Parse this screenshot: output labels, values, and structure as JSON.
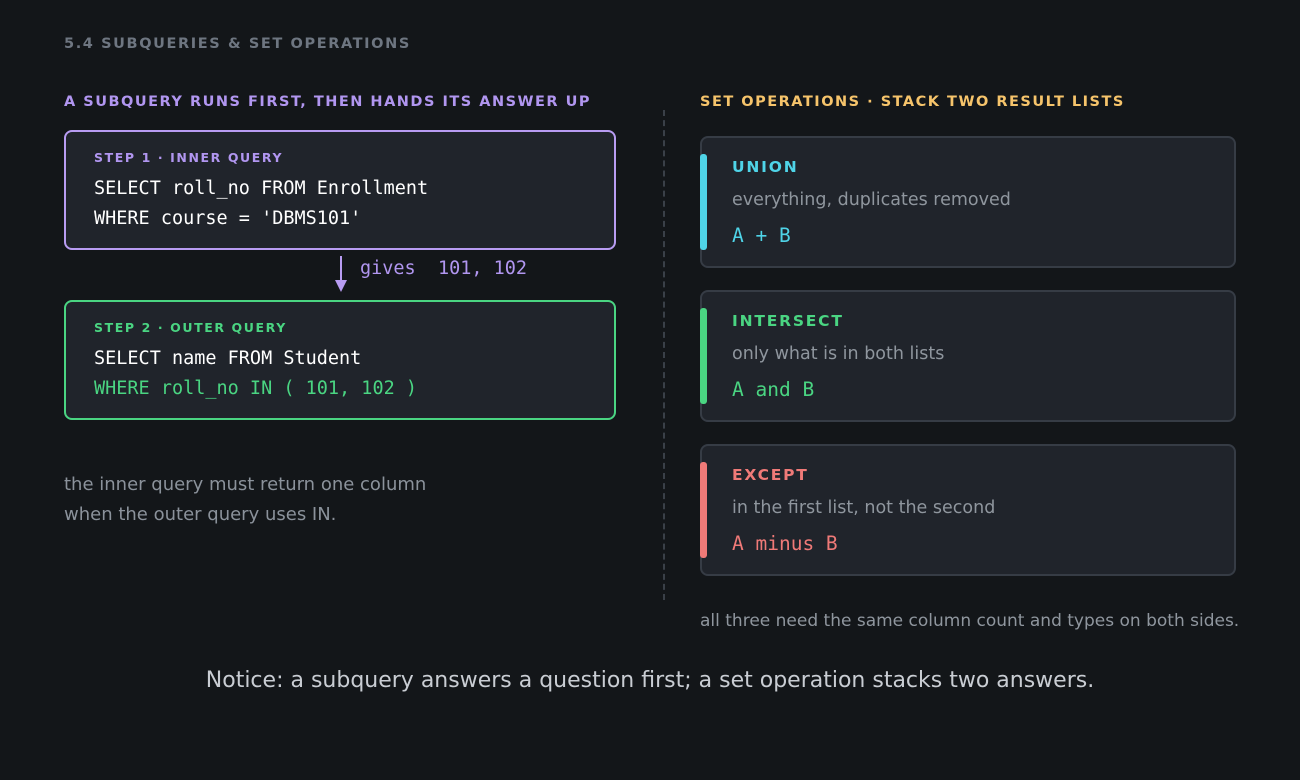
{
  "section_label": "5.4  SUBQUERIES & SET OPERATIONS",
  "left": {
    "heading": "A SUBQUERY RUNS FIRST, THEN HANDS ITS ANSWER UP",
    "inner": {
      "step_label": "STEP 1  ·  INNER QUERY",
      "line1": "SELECT roll_no FROM Enrollment",
      "line2": "WHERE course = 'DBMS101'"
    },
    "gives": "gives  101, 102",
    "outer": {
      "step_label": "STEP 2  ·  OUTER QUERY",
      "line1": "SELECT name FROM Student",
      "line2": "WHERE roll_no IN ( 101, 102 )"
    },
    "note": [
      "the inner query must return one column",
      "when the outer query uses IN."
    ]
  },
  "right": {
    "heading": "SET OPERATIONS  ·  STACK TWO RESULT LISTS",
    "cards": [
      {
        "title": "UNION",
        "desc": "everything, duplicates removed",
        "expr": "A + B",
        "color": "#4fd4e8"
      },
      {
        "title": "INTERSECT",
        "desc": "only what is in both lists",
        "expr": "A and B",
        "color": "#4ad582"
      },
      {
        "title": "EXCEPT",
        "desc": "in the first list, not the second",
        "expr": "A minus B",
        "color": "#f07a78"
      }
    ],
    "note": "all three need the same column count and types on both sides."
  },
  "notice": "Notice: a subquery answers a question first; a set operation stacks two answers.",
  "colors": {
    "background": "#131619",
    "purple": "#b196f0",
    "green": "#4ad582",
    "amber": "#f6c46b",
    "cyan": "#4fd4e8",
    "red": "#f07a78"
  }
}
